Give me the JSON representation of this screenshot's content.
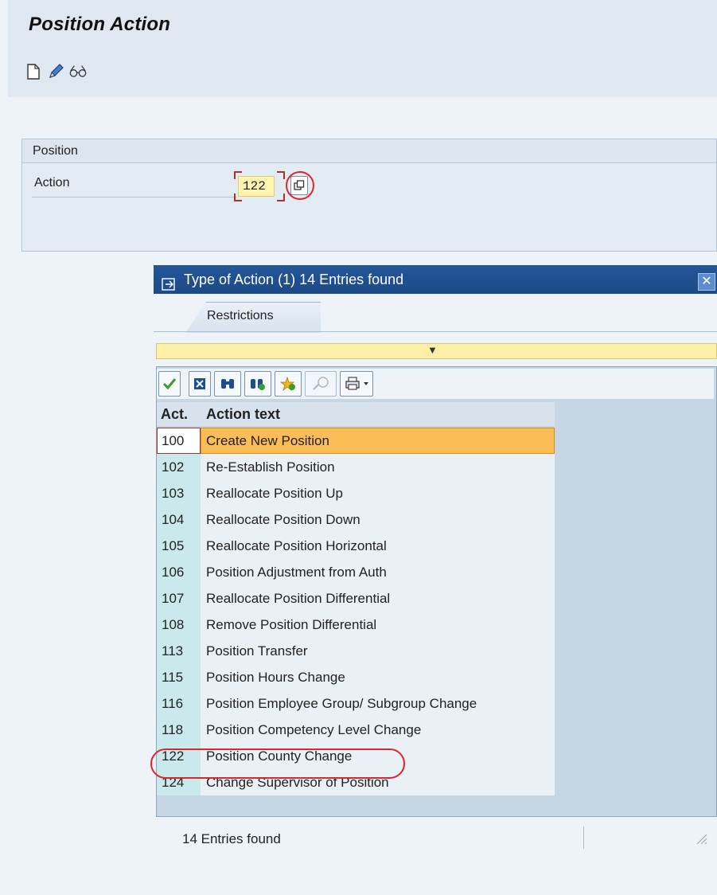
{
  "header": {
    "title": "Position Action"
  },
  "toolbar": {
    "icons": [
      "new-document-icon",
      "edit-pencil-icon",
      "display-glasses-icon"
    ]
  },
  "position_group": {
    "title": "Position",
    "action_label": "Action",
    "action_value": "122"
  },
  "dialog": {
    "title": "Type of Action (1)   14 Entries found",
    "tab_label": "Restrictions",
    "columns": {
      "act": "Act.",
      "text": "Action text"
    },
    "rows": [
      {
        "code": "100",
        "text": "Create New Position"
      },
      {
        "code": "102",
        "text": "Re-Establish Position"
      },
      {
        "code": "103",
        "text": "Reallocate Position Up"
      },
      {
        "code": "104",
        "text": "Reallocate Position Down"
      },
      {
        "code": "105",
        "text": "Reallocate Position Horizontal"
      },
      {
        "code": "106",
        "text": "Position Adjustment from Auth"
      },
      {
        "code": "107",
        "text": "Reallocate Position Differential"
      },
      {
        "code": "108",
        "text": "Remove Position Differential"
      },
      {
        "code": "113",
        "text": "Position Transfer"
      },
      {
        "code": "115",
        "text": "Position Hours Change"
      },
      {
        "code": "116",
        "text": "Position Employee Group/ Subgroup Change"
      },
      {
        "code": "118",
        "text": "Position Competency Level Change"
      },
      {
        "code": "122",
        "text": "Position County Change"
      },
      {
        "code": "124",
        "text": "Change Supervisor of Position"
      }
    ],
    "status": "14 Entries found"
  },
  "colors": {
    "accent_title_bar": "#1f4f91",
    "selected_row": "#fbbd55",
    "highlight_circle": "#e0242c",
    "input_bg": "#fff5b0"
  }
}
